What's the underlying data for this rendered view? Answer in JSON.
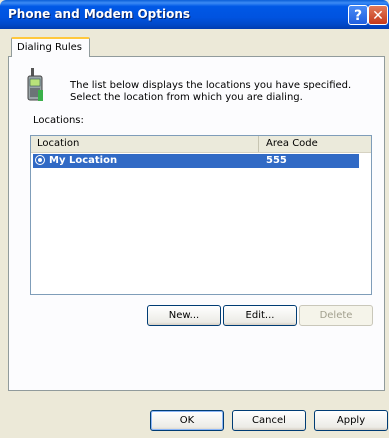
{
  "window": {
    "title": "Phone and Modem Options",
    "help_glyph": "?",
    "close_glyph": "✕"
  },
  "tabs": [
    {
      "label": "Dialing Rules",
      "active": true
    }
  ],
  "description": "The list below displays the locations you have specified. Select the location from which you are dialing.",
  "locations_label": "Locations:",
  "list": {
    "columns": [
      "Location",
      "Area Code"
    ],
    "rows": [
      {
        "name": "My Location",
        "area_code": "555",
        "selected": true
      }
    ]
  },
  "list_buttons": {
    "new": "New...",
    "edit": "Edit...",
    "delete": "Delete"
  },
  "dialog_buttons": {
    "ok": "OK",
    "cancel": "Cancel",
    "apply": "Apply"
  },
  "colors": {
    "titlebar": "#0054E3",
    "selection": "#316AC5",
    "dialog_bg": "#ECE9D8",
    "tab_accent": "#FFC83C"
  }
}
